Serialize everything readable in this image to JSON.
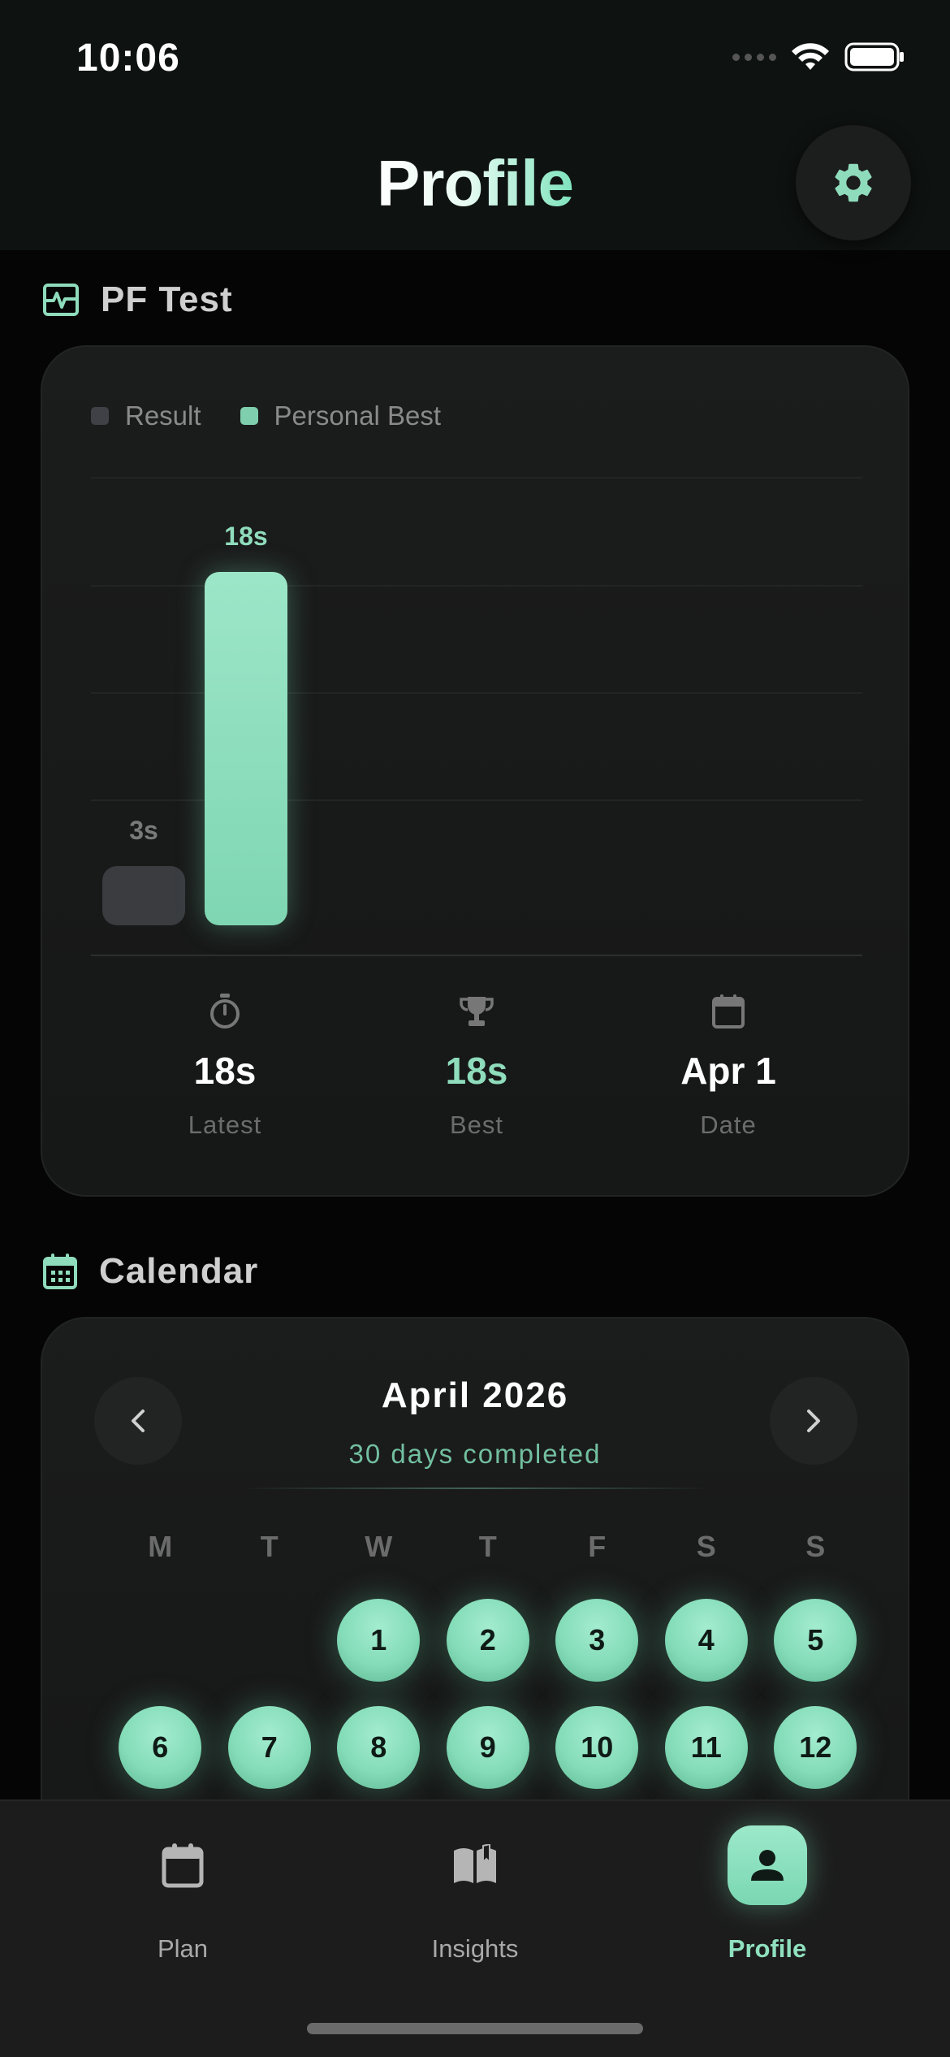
{
  "status_bar": {
    "time": "10:06"
  },
  "header": {
    "title": "Profile"
  },
  "pf_test": {
    "section_title": "PF Test",
    "legend": {
      "result": "Result",
      "personal_best": "Personal Best"
    },
    "chart_data": {
      "type": "bar",
      "categories": [
        "Result",
        "Personal Best"
      ],
      "series": [
        {
          "name": "Result",
          "values": [
            3
          ],
          "color": "#3a3c40"
        },
        {
          "name": "Personal Best",
          "values": [
            18
          ],
          "color": "#8fdcbc"
        }
      ],
      "value_labels": [
        "3s",
        "18s"
      ],
      "ylim": [
        0,
        22
      ],
      "grid": true,
      "legend_position": "top-left"
    },
    "stats": {
      "latest": {
        "value": "18s",
        "caption": "Latest"
      },
      "best": {
        "value": "18s",
        "caption": "Best"
      },
      "date": {
        "value": "Apr 1",
        "caption": "Date"
      }
    }
  },
  "calendar": {
    "section_title": "Calendar",
    "month_title": "April 2026",
    "subtitle": "30 days completed",
    "weekdays": [
      "M",
      "T",
      "W",
      "T",
      "F",
      "S",
      "S"
    ],
    "first_weekday_offset": 2,
    "days": [
      "1",
      "2",
      "3",
      "4",
      "5",
      "6",
      "7",
      "8",
      "9",
      "10",
      "11",
      "12"
    ]
  },
  "tab_bar": {
    "tabs": [
      {
        "label": "Plan",
        "icon": "calendar-icon",
        "active": false
      },
      {
        "label": "Insights",
        "icon": "book-icon",
        "active": false
      },
      {
        "label": "Profile",
        "icon": "person-icon",
        "active": true
      }
    ]
  },
  "colors": {
    "accent": "#8fdcbc",
    "background": "#050505",
    "card": "#1b1c1c"
  }
}
